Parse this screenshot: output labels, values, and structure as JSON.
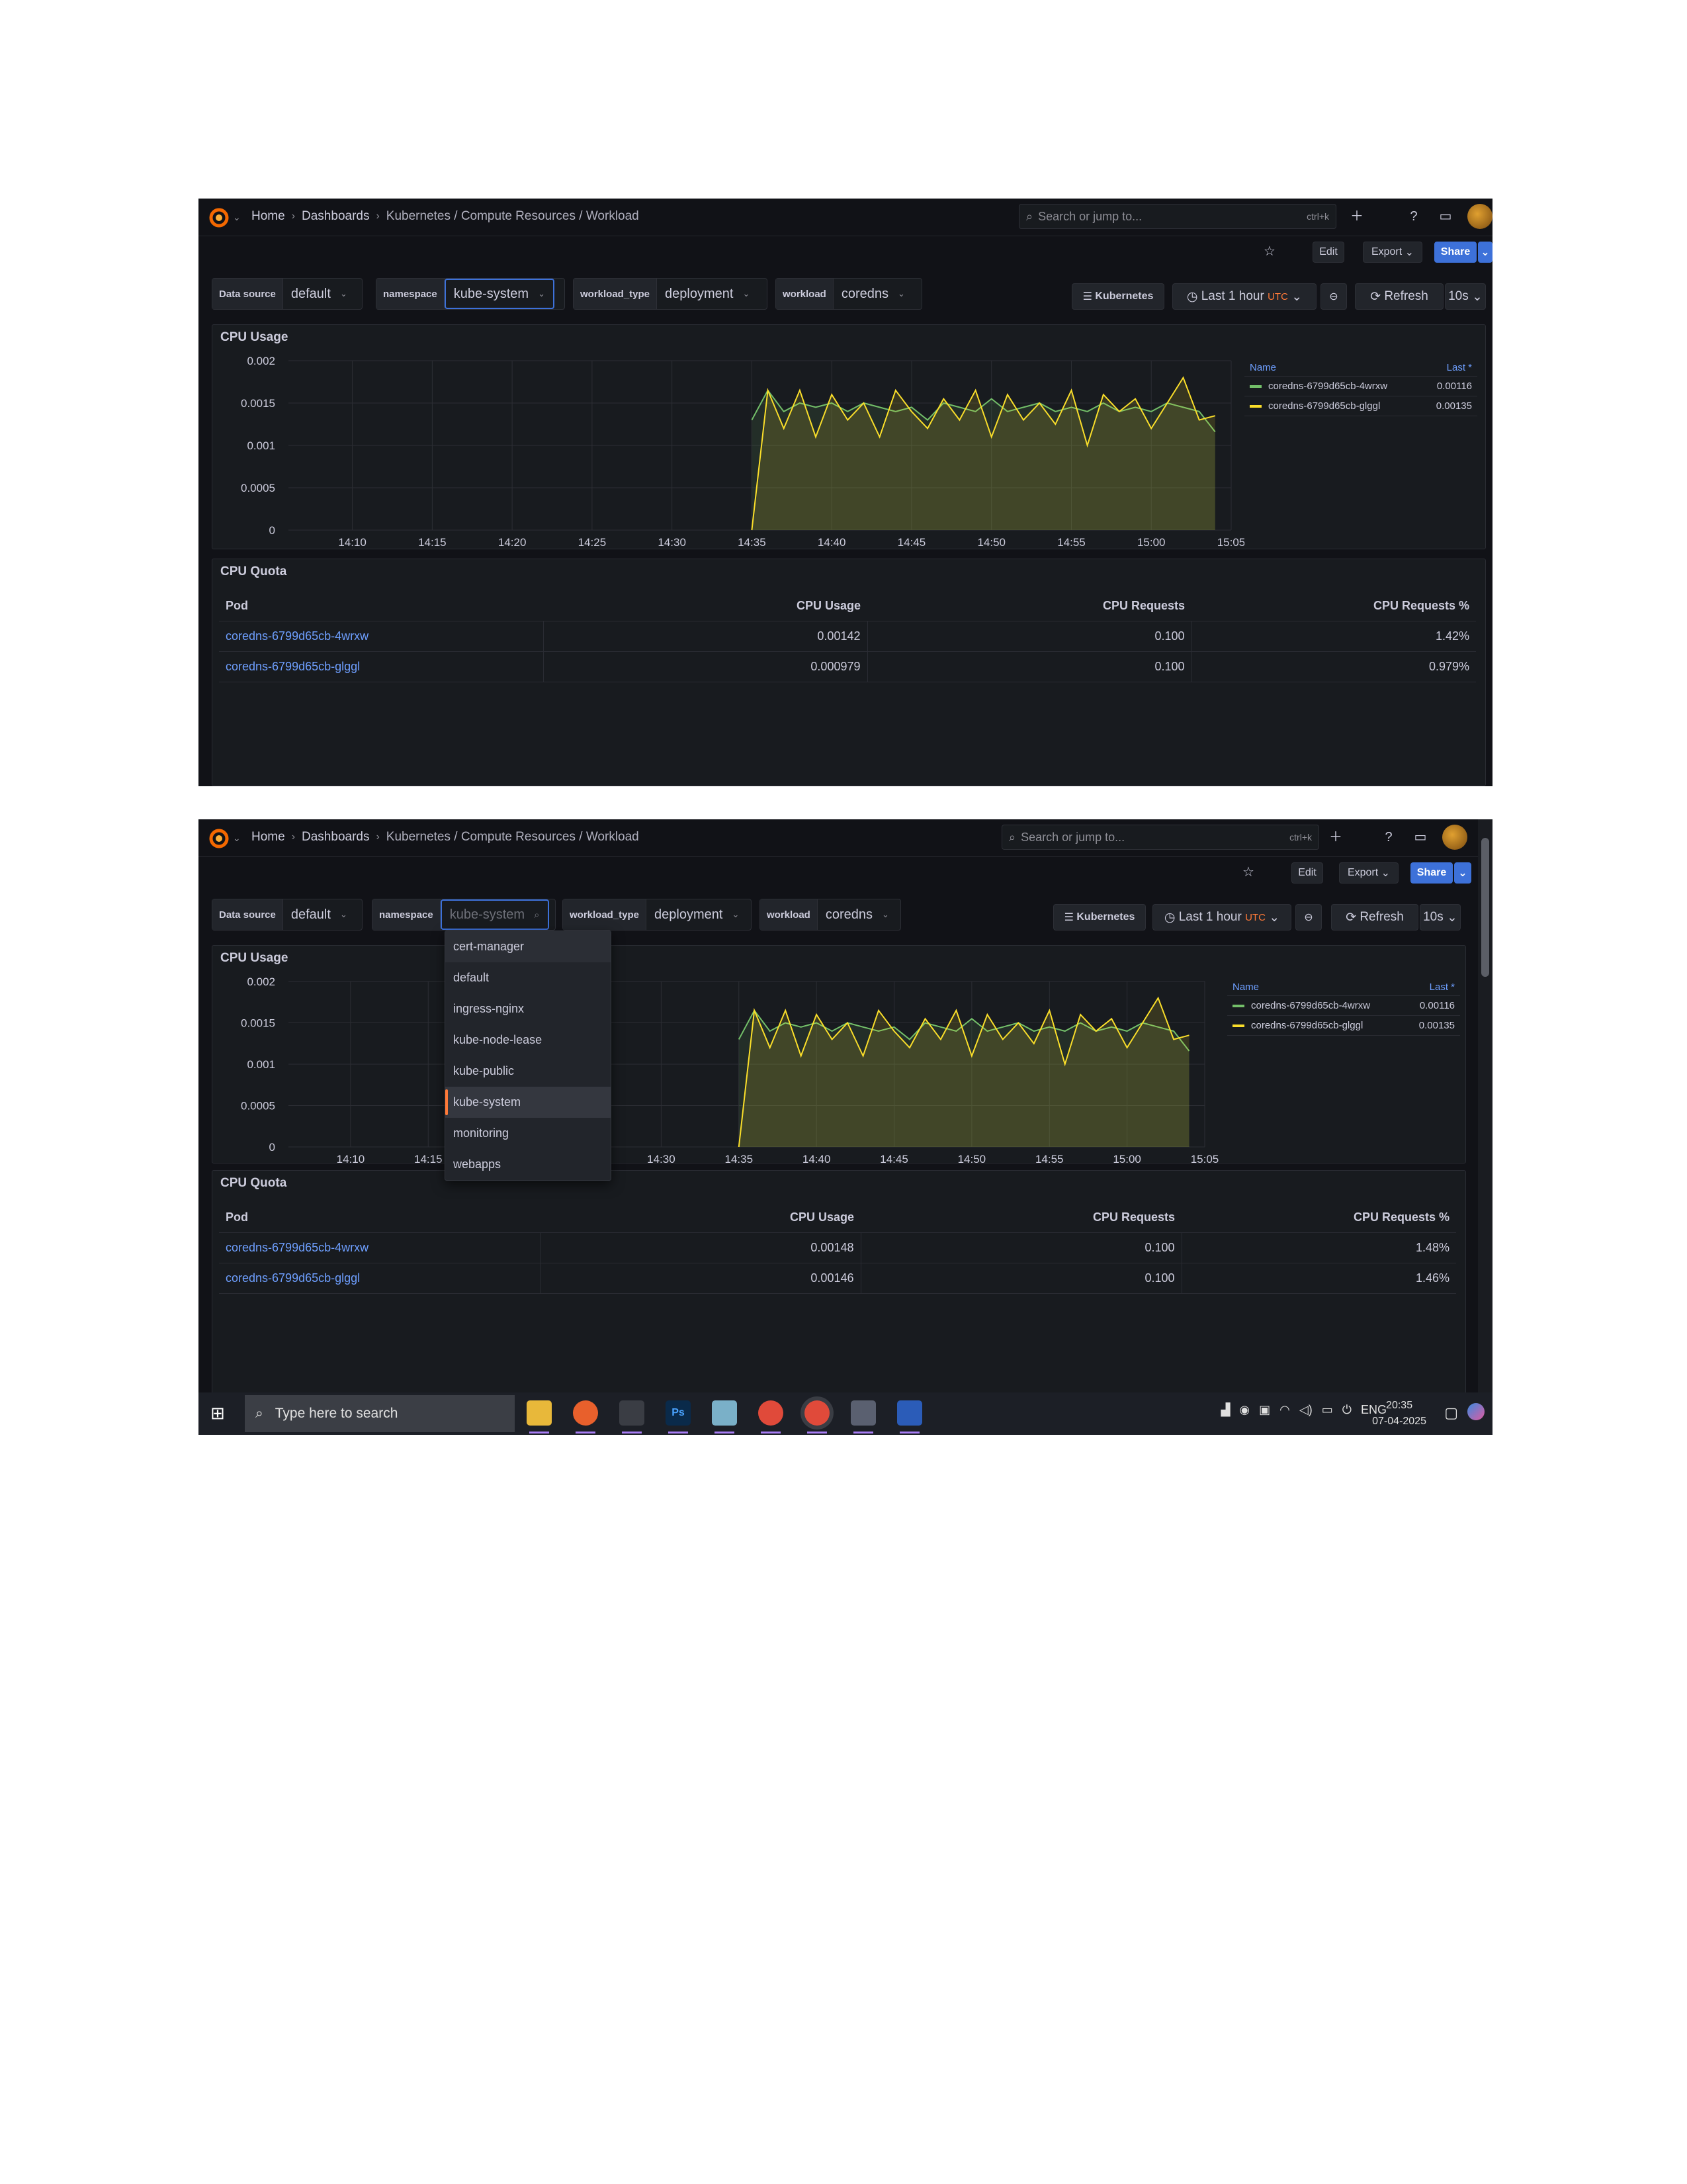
{
  "breadcrumb": {
    "home": "Home",
    "dashboards": "Dashboards",
    "current": "Kubernetes / Compute Resources / Workload"
  },
  "search": {
    "placeholder": "Search or jump to...",
    "shortcut": "ctrl+k"
  },
  "toolbar": {
    "edit": "Edit",
    "export": "Export",
    "share": "Share"
  },
  "variables": {
    "datasource_label": "Data source",
    "datasource_value": "default",
    "namespace_label": "namespace",
    "namespace_value": "kube-system",
    "workload_type_label": "workload_type",
    "workload_type_value": "deployment",
    "workload_label": "workload",
    "workload_value": "coredns"
  },
  "controls": {
    "kubernetes": "Kubernetes",
    "time_range": "Last 1 hour",
    "timezone": "UTC",
    "refresh": "Refresh",
    "interval": "10s"
  },
  "cpu_usage_panel": {
    "title": "CPU Usage",
    "legend_name_header": "Name",
    "legend_last_header": "Last *",
    "legend": [
      {
        "name": "coredns-6799d65cb-4wrxw",
        "last": "0.00116",
        "color": "#73bf69"
      },
      {
        "name": "coredns-6799d65cb-glggl",
        "last": "0.00135",
        "color": "#fade2a"
      }
    ]
  },
  "chart_data": {
    "type": "area",
    "x": [
      "14:35",
      "14:36",
      "14:37",
      "14:38",
      "14:39",
      "14:40",
      "14:41",
      "14:42",
      "14:43",
      "14:44",
      "14:45",
      "14:46",
      "14:47",
      "14:48",
      "14:49",
      "14:50",
      "14:51",
      "14:52",
      "14:53",
      "14:54",
      "14:55",
      "14:56",
      "14:57",
      "14:58",
      "14:59",
      "15:00",
      "15:01",
      "15:02",
      "15:03",
      "15:04"
    ],
    "x_ticks": [
      "14:10",
      "14:15",
      "14:20",
      "14:25",
      "14:30",
      "14:35",
      "14:40",
      "14:45",
      "14:50",
      "14:55",
      "15:00",
      "15:05"
    ],
    "y_ticks": [
      "0",
      "0.0005",
      "0.001",
      "0.0015",
      "0.002"
    ],
    "ylim": [
      0,
      0.002
    ],
    "series": [
      {
        "name": "coredns-6799d65cb-4wrxw",
        "color": "#73bf69",
        "values": [
          0.0013,
          0.00165,
          0.0014,
          0.0015,
          0.00145,
          0.0015,
          0.0014,
          0.0015,
          0.00145,
          0.0014,
          0.00145,
          0.0013,
          0.0015,
          0.00145,
          0.0014,
          0.00155,
          0.0014,
          0.00145,
          0.0015,
          0.0014,
          0.00145,
          0.0014,
          0.0015,
          0.0014,
          0.00145,
          0.0014,
          0.0015,
          0.00145,
          0.0014,
          0.00116
        ]
      },
      {
        "name": "coredns-6799d65cb-glggl",
        "color": "#fade2a",
        "values": [
          0.0,
          0.00165,
          0.0012,
          0.00165,
          0.0011,
          0.0016,
          0.0013,
          0.0015,
          0.0011,
          0.00165,
          0.0014,
          0.0012,
          0.00155,
          0.0013,
          0.00165,
          0.0011,
          0.0016,
          0.0013,
          0.0015,
          0.00125,
          0.00165,
          0.001,
          0.0016,
          0.0014,
          0.00155,
          0.0012,
          0.0015,
          0.0018,
          0.0013,
          0.00135
        ]
      }
    ]
  },
  "cpu_quota_panel": {
    "title": "CPU Quota",
    "columns": [
      "Pod",
      "CPU Usage",
      "CPU Requests",
      "CPU Requests %"
    ],
    "rows_shot1": [
      [
        "coredns-6799d65cb-4wrxw",
        "0.00142",
        "0.100",
        "1.42%"
      ],
      [
        "coredns-6799d65cb-glggl",
        "0.000979",
        "0.100",
        "0.979%"
      ]
    ],
    "rows_shot2": [
      [
        "coredns-6799d65cb-4wrxw",
        "0.00148",
        "0.100",
        "1.48%"
      ],
      [
        "coredns-6799d65cb-glggl",
        "0.00146",
        "0.100",
        "1.46%"
      ]
    ]
  },
  "namespace_dropdown": {
    "options": [
      "cert-manager",
      "default",
      "ingress-nginx",
      "kube-node-lease",
      "kube-public",
      "kube-system",
      "monitoring",
      "webapps"
    ],
    "selected": "kube-system"
  },
  "taskbar": {
    "search_placeholder": "Type here to search",
    "lang": "ENG",
    "time": "20:35",
    "date": "07-04-2025"
  }
}
